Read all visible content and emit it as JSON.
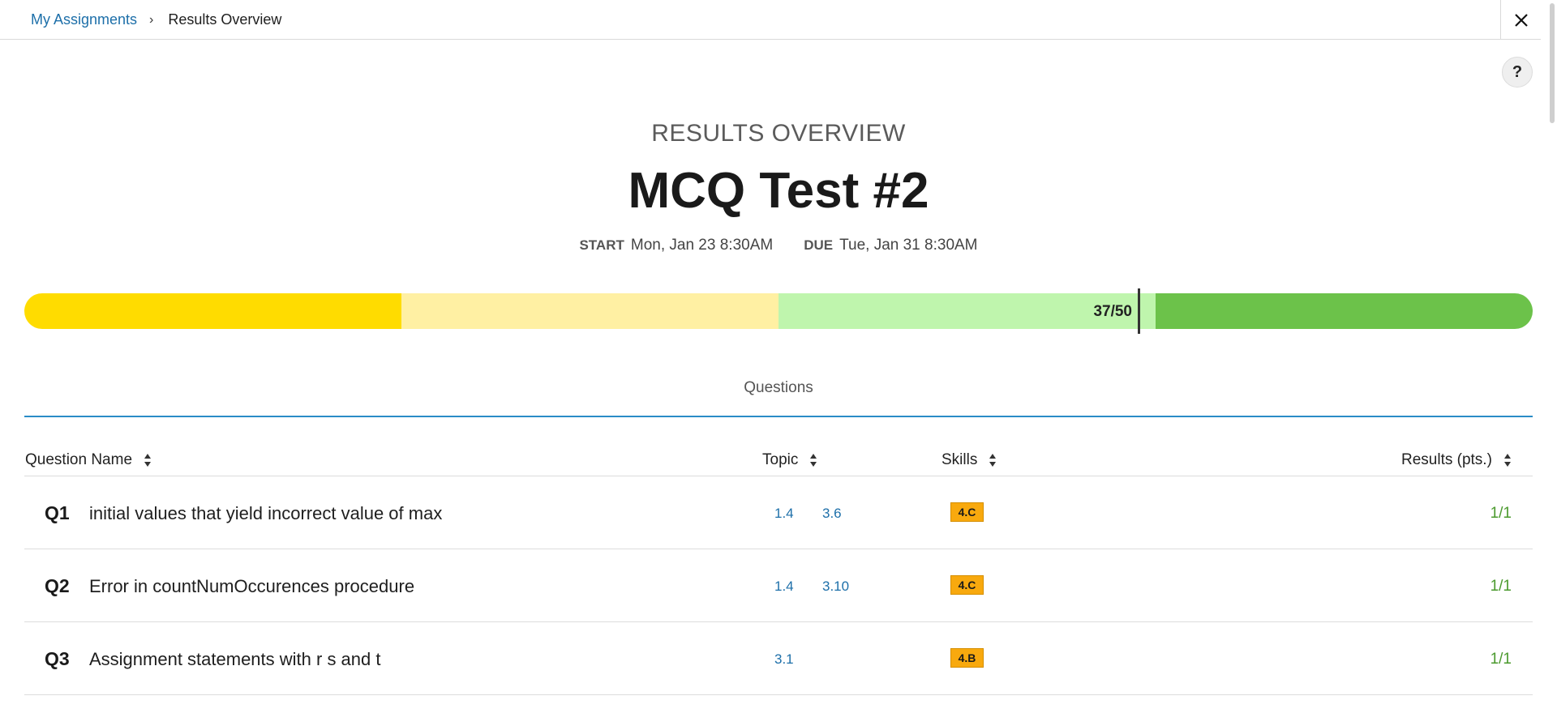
{
  "breadcrumb": {
    "parent": "My Assignments",
    "separator": "›",
    "current": "Results Overview"
  },
  "help_label": "?",
  "header": {
    "eyebrow": "RESULTS OVERVIEW",
    "title": "MCQ Test #2",
    "start_label": "START",
    "start_value": "Mon, Jan 23 8:30AM",
    "due_label": "DUE",
    "due_value": "Tue, Jan 31 8:30AM"
  },
  "score": {
    "text": "37/50",
    "points": 37,
    "max": 50,
    "bands_colors": [
      "#ffdc00",
      "#fff0a3",
      "#bff5ad",
      "#6cc24a"
    ]
  },
  "section": {
    "tab_label": "Questions"
  },
  "table": {
    "columns": {
      "name": "Question Name",
      "topic": "Topic",
      "skills": "Skills",
      "results": "Results (pts.)"
    },
    "rows": [
      {
        "num": "Q1",
        "name": "initial values that yield incorrect value of max",
        "topics": [
          "1.4",
          "3.6"
        ],
        "skill": "4.C",
        "result": "1/1"
      },
      {
        "num": "Q2",
        "name": "Error in countNumOccurences procedure",
        "topics": [
          "1.4",
          "3.10"
        ],
        "skill": "4.C",
        "result": "1/1"
      },
      {
        "num": "Q3",
        "name": "Assignment statements with r s and t",
        "topics": [
          "3.1"
        ],
        "skill": "4.B",
        "result": "1/1"
      }
    ]
  },
  "colors": {
    "link": "#1d6fa9",
    "accent_line": "#2a8cc7",
    "skill_badge": "#f8a90e",
    "result_text": "#4b9a2e"
  }
}
